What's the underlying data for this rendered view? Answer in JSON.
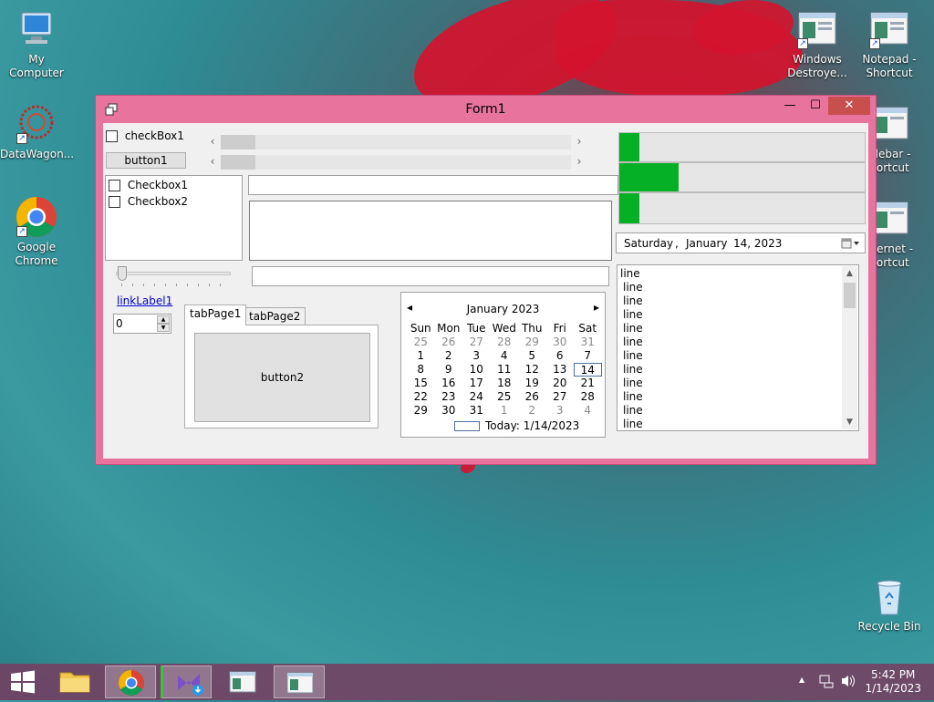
{
  "desktop": {
    "icons_left": [
      {
        "label": "My Computer",
        "icon": "computer-icon"
      },
      {
        "label": "DataWagon...",
        "icon": "datawagon-icon"
      },
      {
        "label": "Google\nChrome",
        "icon": "chrome-icon"
      }
    ],
    "icons_right": [
      {
        "label": "Windows\nDestroye...",
        "icon": "app-window-icon"
      },
      {
        "label": "Notepad -\nShortcut",
        "icon": "app-window-icon"
      },
      {
        "label": "itlebar -\nhortcut",
        "icon": "app-window-icon"
      },
      {
        "label": "nternet -\nhortcut",
        "icon": "app-window-icon"
      }
    ],
    "recycle_bin": "Recycle Bin"
  },
  "window": {
    "title": "Form1",
    "minimize_glyph": "—",
    "maximize_glyph": "☐",
    "close_glyph": "✕"
  },
  "form": {
    "checkbox1": "checkBox1",
    "button1": "button1",
    "checked_list": [
      "Checkbox1",
      "Checkbox2"
    ],
    "link_label": "linkLabel1",
    "numeric_value": "0",
    "tabs": [
      "tabPage1",
      "tabPage2"
    ],
    "button2": "button2",
    "textbox1_value": "",
    "textbox2_value": "",
    "textbox3_value": "",
    "scroll_left_glyph": "‹",
    "scroll_right_glyph": "›",
    "progress": [
      0.08,
      0.24,
      0.08
    ],
    "date_picker": {
      "day": "Saturday",
      "sep": ",",
      "month": "January",
      "date": "14, 2023"
    },
    "listbox_items": [
      "line",
      "line",
      "line",
      "line",
      "line",
      "line",
      "line",
      "line",
      "line",
      "line",
      "line",
      "line"
    ]
  },
  "calendar": {
    "month_title": "January 2023",
    "prev_glyph": "◂",
    "next_glyph": "▸",
    "weekdays": [
      "Sun",
      "Mon",
      "Tue",
      "Wed",
      "Thu",
      "Fri",
      "Sat"
    ],
    "weeks": [
      [
        "25",
        "26",
        "27",
        "28",
        "29",
        "30",
        "31"
      ],
      [
        "1",
        "2",
        "3",
        "4",
        "5",
        "6",
        "7"
      ],
      [
        "8",
        "9",
        "10",
        "11",
        "12",
        "13",
        "14"
      ],
      [
        "15",
        "16",
        "17",
        "18",
        "19",
        "20",
        "21"
      ],
      [
        "22",
        "23",
        "24",
        "25",
        "26",
        "27",
        "28"
      ],
      [
        "29",
        "30",
        "31",
        "1",
        "2",
        "3",
        "4"
      ]
    ],
    "today_label": "Today: 1/14/2023",
    "selected_day": "14"
  },
  "taskbar": {
    "time": "5:42 PM",
    "date": "1/14/2023",
    "tray_up_glyph": "▲"
  },
  "colors": {
    "window_border": "#e8739d",
    "progress_fill": "#06b025",
    "close_button": "#c7504f"
  }
}
